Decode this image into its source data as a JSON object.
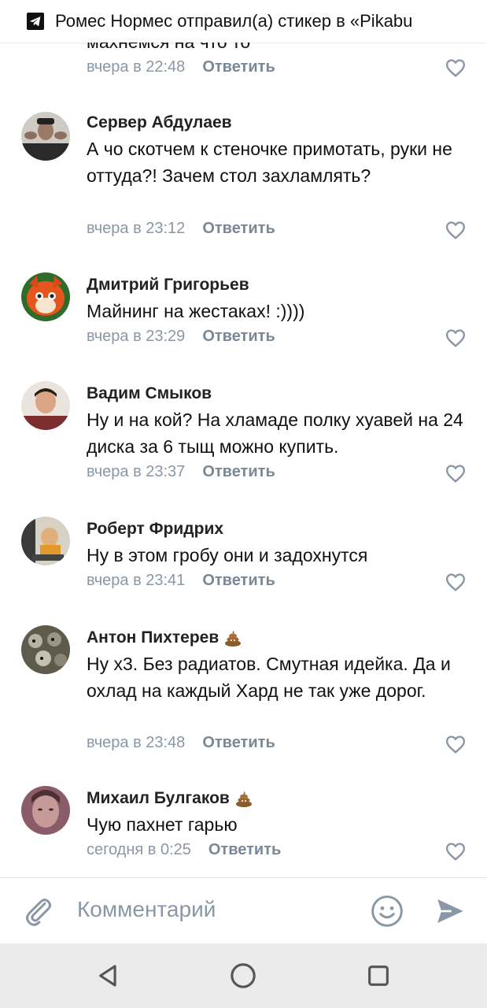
{
  "notification": {
    "app_icon": "telegram-icon",
    "text": "Ромес Нормес отправил(а) стикер в «Pikabu"
  },
  "partial_comment": {
    "text_fragment": "махнемся на что то",
    "time": "вчера в 22:48",
    "reply_label": "Ответить"
  },
  "comments": [
    {
      "author": "Сервер Абдулаев",
      "text": "А чо скотчем к стеночке примотать, руки не оттуда?! Зачем стол захламлять?",
      "time": "вчера в 23:12",
      "reply_label": "Ответить",
      "badge_icon": null
    },
    {
      "author": "Дмитрий Григорьев",
      "text": "Майнинг на жестаках! :))))",
      "time": "вчера в 23:29",
      "reply_label": "Ответить",
      "badge_icon": null
    },
    {
      "author": "Вадим Смыков",
      "text": "Ну и на кой? На хламаде полку хуавей на 24 диска за 6 тыщ можно купить.",
      "time": "вчера в 23:37",
      "reply_label": "Ответить",
      "badge_icon": null
    },
    {
      "author": "Роберт Фридрих",
      "text": "Ну в этом гробу они и задохнутся",
      "time": "вчера в 23:41",
      "reply_label": "Ответить",
      "badge_icon": null
    },
    {
      "author": "Антон Пихтерев",
      "text": "Ну х3. Без радиатов. Смутная идейка. Да и охлад на каждый Хард не так уже дорог.",
      "time": "вчера в 23:48",
      "reply_label": "Ответить",
      "badge_icon": "poop-emoji-icon"
    },
    {
      "author": "Михаил Булгаков",
      "text": "Чую пахнет гарью",
      "time": "сегодня в 0:25",
      "reply_label": "Ответить",
      "badge_icon": "poop-emoji-icon"
    }
  ],
  "composer": {
    "attach_icon": "paperclip-icon",
    "placeholder": "Комментарий",
    "emoji_icon": "smile-icon",
    "send_icon": "send-icon"
  },
  "navbar": {
    "back_icon": "back-triangle-icon",
    "home_icon": "home-circle-icon",
    "recents_icon": "recents-square-icon"
  },
  "colors": {
    "accent": "#7a8896",
    "meta_text": "#8a97a6",
    "text": "#111111",
    "navbar_bg": "#ebebeb"
  }
}
